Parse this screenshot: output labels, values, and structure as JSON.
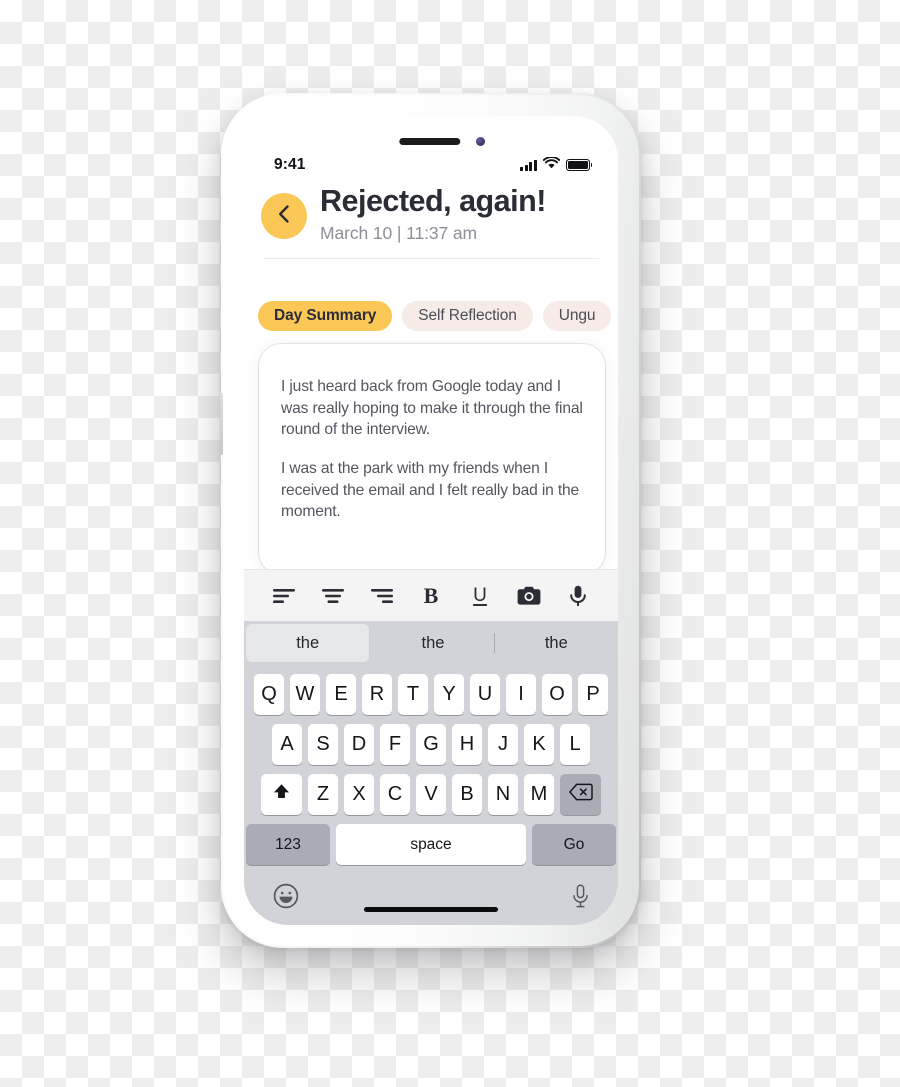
{
  "status_bar": {
    "time": "9:41",
    "signal_icon": "cellular-signal-icon",
    "wifi_icon": "wifi-icon",
    "battery_icon": "battery-full-icon"
  },
  "header": {
    "back_icon": "chevron-left-icon",
    "title": "Rejected, again!",
    "subtitle": "March 10 | 11:37 am"
  },
  "tabs": [
    {
      "label": "Day Summary",
      "active": true
    },
    {
      "label": "Self Reflection",
      "active": false
    },
    {
      "label": "Ungu",
      "active": false
    }
  ],
  "note": {
    "paragraphs": [
      "I just heard back from Google today and I was really hoping to make it through the final round of the interview.",
      "I was at the park with my friends when I received the email and I felt really bad in the moment."
    ]
  },
  "format_toolbar": [
    {
      "name": "align-left-icon",
      "label": ""
    },
    {
      "name": "align-center-icon",
      "label": ""
    },
    {
      "name": "align-right-icon",
      "label": ""
    },
    {
      "name": "bold-icon",
      "label": "B"
    },
    {
      "name": "underline-icon",
      "label": "U"
    },
    {
      "name": "camera-icon",
      "label": ""
    },
    {
      "name": "microphone-icon",
      "label": ""
    }
  ],
  "keyboard": {
    "suggestions": [
      "the",
      "the",
      "the"
    ],
    "row1": [
      "Q",
      "W",
      "E",
      "R",
      "T",
      "Y",
      "U",
      "I",
      "O",
      "P"
    ],
    "row2": [
      "A",
      "S",
      "D",
      "F",
      "G",
      "H",
      "J",
      "K",
      "L"
    ],
    "row3": [
      "Z",
      "X",
      "C",
      "V",
      "B",
      "N",
      "M"
    ],
    "shift_icon": "shift-up-arrow-icon",
    "backspace_icon": "backspace-delete-icon",
    "numbers_key": "123",
    "space_key": "space",
    "go_key": "Go",
    "emoji_icon": "emoji-smiley-icon",
    "dictation_icon": "microphone-icon"
  },
  "colors": {
    "accent_yellow": "#fbc756",
    "tab_inactive": "#f6ebe7",
    "text_dark": "#2b2d36",
    "text_muted": "#8d8f98",
    "note_text": "#54565f",
    "keyboard_bg": "#d1d3d9",
    "key_white": "#ffffff",
    "key_gray": "#a9acb5"
  }
}
